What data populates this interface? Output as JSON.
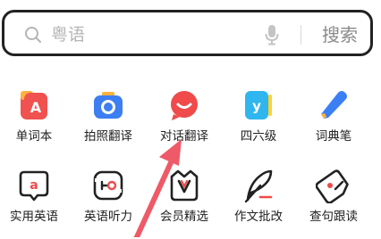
{
  "search": {
    "placeholder": "粤语",
    "button_label": "搜索"
  },
  "tools": [
    {
      "label": "单词本",
      "icon": "wordbook-icon",
      "color": "#f0524f"
    },
    {
      "label": "拍照翻译",
      "icon": "camera-icon",
      "color": "#3d7ff2"
    },
    {
      "label": "对话翻译",
      "icon": "dialogue-icon",
      "color": "#f04a4a"
    },
    {
      "label": "四六级",
      "icon": "cet-icon",
      "color": "#2fb6ee"
    },
    {
      "label": "词典笔",
      "icon": "pen-icon",
      "color": "#3b7ff5"
    },
    {
      "label": "实用英语",
      "icon": "practical-english-icon",
      "color": "#222222"
    },
    {
      "label": "英语听力",
      "icon": "listening-icon",
      "color": "#222222"
    },
    {
      "label": "会员精选",
      "icon": "vip-icon",
      "color": "#222222"
    },
    {
      "label": "作文批改",
      "icon": "essay-icon",
      "color": "#222222"
    },
    {
      "label": "查句跟读",
      "icon": "read-along-icon",
      "color": "#222222"
    }
  ]
}
